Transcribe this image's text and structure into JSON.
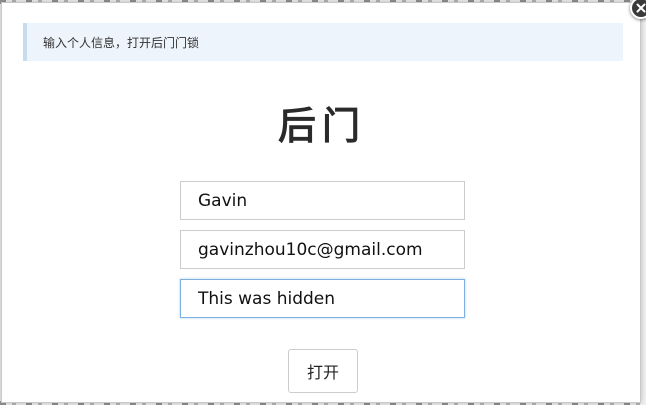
{
  "dialog": {
    "info_text": "输入个人信息，打开后门门锁",
    "title": "后门"
  },
  "form": {
    "name_value": "Gavin",
    "email_value": "gavinzhou10c@gmail.com",
    "secret_value": "This was hidden"
  },
  "actions": {
    "open_label": "打开"
  },
  "icons": {
    "close": "close-icon"
  },
  "colors": {
    "info_background": "#edf4fb",
    "info_border": "#c8dcef",
    "focus_border": "#7fb1e0"
  }
}
